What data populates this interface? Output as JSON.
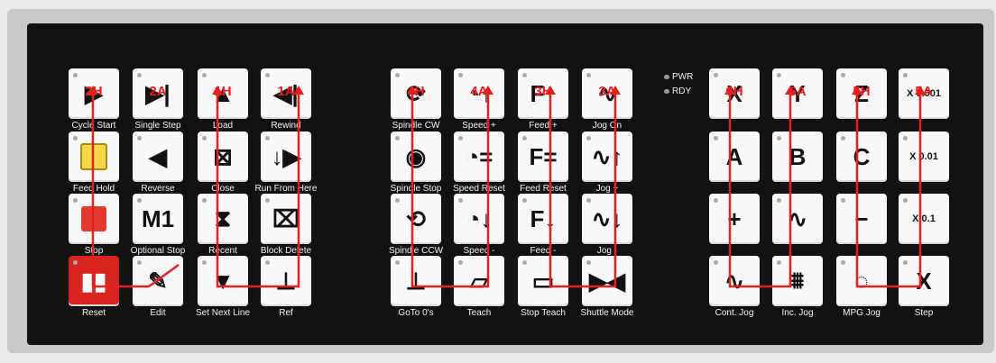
{
  "indicators": {
    "pwr": "PWR",
    "rdy": "RDY"
  },
  "colors": {
    "accent_red": "#e61e1e",
    "reset_red": "#d8241f",
    "hold_yellow": "#f4d64a",
    "stop_red": "#e23a2f"
  },
  "keys": [
    {
      "id": "cycle-start",
      "label": "Cycle Start",
      "icon": "play-icon",
      "glyph": "▶",
      "tag": "2H"
    },
    {
      "id": "single-step",
      "label": "Single Step",
      "icon": "step-forward-icon",
      "glyph": "▶|",
      "tag": "2A"
    },
    {
      "id": "load",
      "label": "Load",
      "icon": "load-icon",
      "glyph": "▲",
      "tag": "1H"
    },
    {
      "id": "rewind",
      "label": "Rewind",
      "icon": "rewind-icon",
      "glyph": "◀|",
      "tag": "1A"
    },
    {
      "id": "feed-hold",
      "label": "Feed Hold",
      "icon": "pause-icon",
      "glyph": "",
      "tag": ""
    },
    {
      "id": "reverse",
      "label": "Reverse",
      "icon": "reverse-icon",
      "glyph": "◀",
      "tag": ""
    },
    {
      "id": "close",
      "label": "Close",
      "icon": "close-icon",
      "glyph": "⊠",
      "tag": ""
    },
    {
      "id": "run-from-here",
      "label": "Run From Here",
      "icon": "run-from-here-icon",
      "glyph": "↓▶",
      "tag": ""
    },
    {
      "id": "stop",
      "label": "Stop",
      "icon": "stop-icon",
      "glyph": "",
      "tag": ""
    },
    {
      "id": "optional-stop",
      "label": "Optional Stop",
      "icon": "m1-icon",
      "glyph": "M1",
      "tag": ""
    },
    {
      "id": "recent",
      "label": "Recent",
      "icon": "recent-icon",
      "glyph": "⧗",
      "tag": ""
    },
    {
      "id": "block-delete",
      "label": "Block Delete",
      "icon": "block-delete-icon",
      "glyph": "⌧",
      "tag": ""
    },
    {
      "id": "reset",
      "label": "Reset",
      "icon": "reset-icon",
      "glyph": "▮▮",
      "tag": ""
    },
    {
      "id": "edit",
      "label": "Edit",
      "icon": "pencil-icon",
      "glyph": "✎",
      "tag": ""
    },
    {
      "id": "set-next-line",
      "label": "Set Next Line",
      "icon": "set-next-line-icon",
      "glyph": "▼",
      "tag": ""
    },
    {
      "id": "ref",
      "label": "Ref",
      "icon": "axes-icon",
      "glyph": "⊥",
      "tag": ""
    },
    {
      "id": "spindle-cw",
      "label": "Spindle CW",
      "icon": "spindle-cw-icon",
      "glyph": "⟳",
      "tag": "4H"
    },
    {
      "id": "speed-plus",
      "label": "Speed +",
      "icon": "speed-up-icon",
      "glyph": "◔↑",
      "tag": "4A"
    },
    {
      "id": "feed-plus",
      "label": "Feed +",
      "icon": "feed-up-icon",
      "glyph": "F↑",
      "tag": "3H"
    },
    {
      "id": "jog-on",
      "label": "Jog On",
      "icon": "jog-on-icon",
      "glyph": "∿",
      "tag": "3A"
    },
    {
      "id": "spindle-stop",
      "label": "Spindle Stop",
      "icon": "spindle-stop-icon",
      "glyph": "◉",
      "tag": ""
    },
    {
      "id": "speed-reset",
      "label": "Speed Reset",
      "icon": "speed-reset-icon",
      "glyph": "◔=",
      "tag": ""
    },
    {
      "id": "feed-reset",
      "label": "Feed Reset",
      "icon": "feed-reset-icon",
      "glyph": "F=",
      "tag": ""
    },
    {
      "id": "jog-plus",
      "label": "Jog +",
      "icon": "jog-plus-icon",
      "glyph": "∿↑",
      "tag": ""
    },
    {
      "id": "spindle-ccw",
      "label": "Spindle CCW",
      "icon": "spindle-ccw-icon",
      "glyph": "⟲",
      "tag": ""
    },
    {
      "id": "speed-minus",
      "label": "Speed -",
      "icon": "speed-down-icon",
      "glyph": "◔↓",
      "tag": ""
    },
    {
      "id": "feed-minus",
      "label": "Feed -",
      "icon": "feed-down-icon",
      "glyph": "F↓",
      "tag": ""
    },
    {
      "id": "jog-minus",
      "label": "Jog -",
      "icon": "jog-minus-icon",
      "glyph": "∿↓",
      "tag": ""
    },
    {
      "id": "goto-zeros",
      "label": "GoTo 0's",
      "icon": "goto-zero-icon",
      "glyph": "⊥",
      "tag": ""
    },
    {
      "id": "teach",
      "label": "Teach",
      "icon": "teach-icon",
      "glyph": "▱",
      "tag": ""
    },
    {
      "id": "stop-teach",
      "label": "Stop Teach",
      "icon": "stop-teach-icon",
      "glyph": "▭",
      "tag": ""
    },
    {
      "id": "shuttle-mode",
      "label": "Shuttle Mode",
      "icon": "shuttle-icon",
      "glyph": "▶◀",
      "tag": ""
    },
    {
      "id": "axis-x",
      "label": "",
      "icon": "x-axis-icon",
      "glyph": "X",
      "tag": "6H"
    },
    {
      "id": "axis-y",
      "label": "",
      "icon": "y-axis-icon",
      "glyph": "Y",
      "tag": "6A"
    },
    {
      "id": "axis-z",
      "label": "",
      "icon": "z-axis-icon",
      "glyph": "Z",
      "tag": "5H"
    },
    {
      "id": "step-x001",
      "label": "",
      "icon": "step-size-icon",
      "glyph": "X 0.001",
      "tag": "5A"
    },
    {
      "id": "axis-a",
      "label": "",
      "icon": "a-axis-icon",
      "glyph": "A",
      "tag": ""
    },
    {
      "id": "axis-b",
      "label": "",
      "icon": "b-axis-icon",
      "glyph": "B",
      "tag": ""
    },
    {
      "id": "axis-c",
      "label": "",
      "icon": "c-axis-icon",
      "glyph": "C",
      "tag": ""
    },
    {
      "id": "step-x01",
      "label": "",
      "icon": "step-size-icon",
      "glyph": "X 0.01",
      "tag": ""
    },
    {
      "id": "jog-plus-dir",
      "label": "",
      "icon": "plus-icon",
      "glyph": "+",
      "tag": ""
    },
    {
      "id": "jog-wave",
      "label": "",
      "icon": "wave-icon",
      "glyph": "∿",
      "tag": ""
    },
    {
      "id": "jog-minus-dir",
      "label": "",
      "icon": "minus-icon",
      "glyph": "−",
      "tag": ""
    },
    {
      "id": "step-x1",
      "label": "",
      "icon": "step-size-icon",
      "glyph": "X 0.1",
      "tag": ""
    },
    {
      "id": "cont-jog",
      "label": "Cont. Jog",
      "icon": "cont-jog-icon",
      "glyph": "∿",
      "tag": ""
    },
    {
      "id": "inc-jog",
      "label": "Inc. Jog",
      "icon": "inc-jog-icon",
      "glyph": "⩩",
      "tag": ""
    },
    {
      "id": "mpg-jog",
      "label": "MPG Jog",
      "icon": "mpg-icon",
      "glyph": "◌",
      "tag": ""
    },
    {
      "id": "step",
      "label": "Step",
      "icon": "step-icon",
      "glyph": "X",
      "tag": ""
    }
  ]
}
